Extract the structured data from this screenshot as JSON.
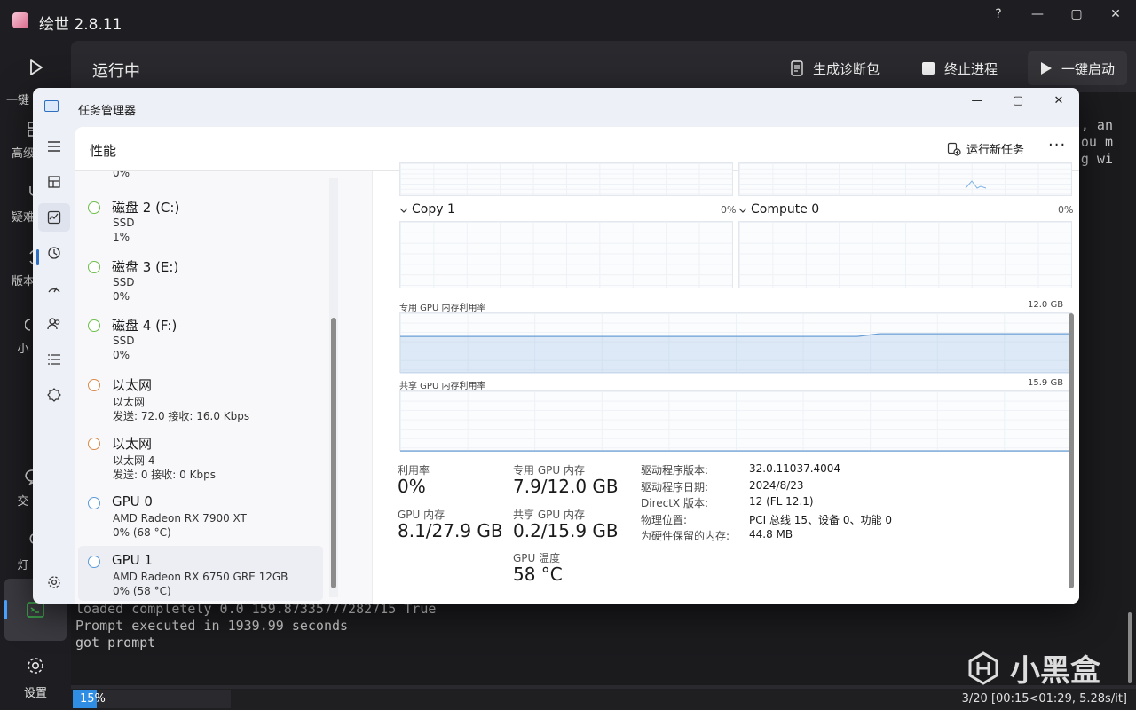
{
  "app": {
    "title": "绘世 2.8.11",
    "window_controls": {
      "help": "?",
      "minimize": "—",
      "maximize": "▢",
      "close": "✕"
    }
  },
  "rail": {
    "items": [
      {
        "label": "一键启动",
        "icon": "play-icon"
      },
      {
        "label": "高级选项",
        "icon": "grid-icon"
      },
      {
        "label": "疑难解答",
        "icon": "stethoscope-icon"
      },
      {
        "label": "版本管理",
        "icon": "history-icon"
      },
      {
        "label": "小工具",
        "icon": "toolbox-icon"
      },
      {
        "label": "交流群",
        "icon": "chat-icon"
      },
      {
        "label": "灯泡",
        "icon": "bulb-icon"
      },
      {
        "label": "控制台",
        "icon": "terminal-icon"
      }
    ],
    "visible_fragments": [
      "一键",
      "高级",
      "疑难",
      "版本",
      "小",
      "交",
      "灯"
    ],
    "settings_label": "设置"
  },
  "header": {
    "title": "运行中",
    "diagnostics_label": "生成诊断包",
    "stop_label": "终止进程",
    "launch_label": "一键启动"
  },
  "console": {
    "right_lines": [
      ", an",
      "ou m",
      "g wi"
    ],
    "lines": [
      "loaded completely 0.0 159.87335777282715 True",
      "Prompt executed in 1939.99 seconds",
      "got prompt"
    ]
  },
  "status": {
    "progress_label": "15%",
    "progress_value": 0.15,
    "right_text": "3/20 [00:15<01:29,  5.28s/it]"
  },
  "watermark": {
    "text": "小黑盒"
  },
  "task_manager": {
    "title": "任务管理器",
    "window_controls": {
      "minimize": "—",
      "maximize": "▢",
      "close": "✕"
    },
    "section_title": "性能",
    "run_new_task_label": "运行新任务",
    "more_label": "···",
    "nav_icons": [
      "hamburger-icon",
      "processes-icon",
      "performance-icon",
      "app-history-icon",
      "startup-icon",
      "users-icon",
      "details-icon",
      "services-icon",
      "settings-icon"
    ],
    "devices": [
      {
        "name": "",
        "line1": "",
        "line2": "0%",
        "ring_color": "#5cb85c"
      },
      {
        "name": "磁盘 2 (C:)",
        "line1": "SSD",
        "line2": "1%",
        "ring_color": "#6cbf4a"
      },
      {
        "name": "磁盘 3 (E:)",
        "line1": "SSD",
        "line2": "0%",
        "ring_color": "#6cbf4a"
      },
      {
        "name": "磁盘 4 (F:)",
        "line1": "SSD",
        "line2": "0%",
        "ring_color": "#6cbf4a"
      },
      {
        "name": "以太网",
        "line1": "以太网",
        "line2": "发送: 72.0 接收: 16.0 Kbps",
        "ring_color": "#d98b4c"
      },
      {
        "name": "以太网",
        "line1": "以太网 4",
        "line2": "发送: 0 接收: 0 Kbps",
        "ring_color": "#d98b4c"
      },
      {
        "name": "GPU 0",
        "line1": "AMD Radeon RX 7900 XT",
        "line2": "0% (68 °C)",
        "ring_color": "#5a9bd8"
      },
      {
        "name": "GPU 1",
        "line1": "AMD Radeon RX 6750 GRE 12GB",
        "line2": "0% (58 °C)",
        "ring_color": "#5a9bd8"
      }
    ],
    "engines": [
      {
        "label": "Copy 1",
        "percent": "0%"
      },
      {
        "label": "Compute 0",
        "percent": "0%"
      }
    ],
    "dedicated_mem": {
      "label": "专用 GPU 内存利用率",
      "max": "12.0 GB",
      "usage_fraction": 0.66
    },
    "shared_mem": {
      "label": "共享 GPU 内存利用率",
      "max": "15.9 GB",
      "usage_fraction": 0.0126
    },
    "stats": {
      "utilization": {
        "label": "利用率",
        "value": "0%"
      },
      "dedicated": {
        "label": "专用 GPU 内存",
        "value": "7.9/12.0 GB"
      },
      "gpu_memory": {
        "label": "GPU 内存",
        "value": "8.1/27.9 GB"
      },
      "shared": {
        "label": "共享 GPU 内存",
        "value": "0.2/15.9 GB"
      },
      "temperature": {
        "label": "GPU 温度",
        "value": "58 °C"
      }
    },
    "info": [
      {
        "key": "驱动程序版本:",
        "value": "32.0.11037.4004"
      },
      {
        "key": "驱动程序日期:",
        "value": "2024/8/23"
      },
      {
        "key": "DirectX 版本:",
        "value": "12 (FL 12.1)"
      },
      {
        "key": "物理位置:",
        "value": "PCI 总线 15、设备 0、功能 0"
      },
      {
        "key": "为硬件保留的内存:",
        "value": "44.8 MB"
      }
    ],
    "accent": "#2f6fc0"
  }
}
